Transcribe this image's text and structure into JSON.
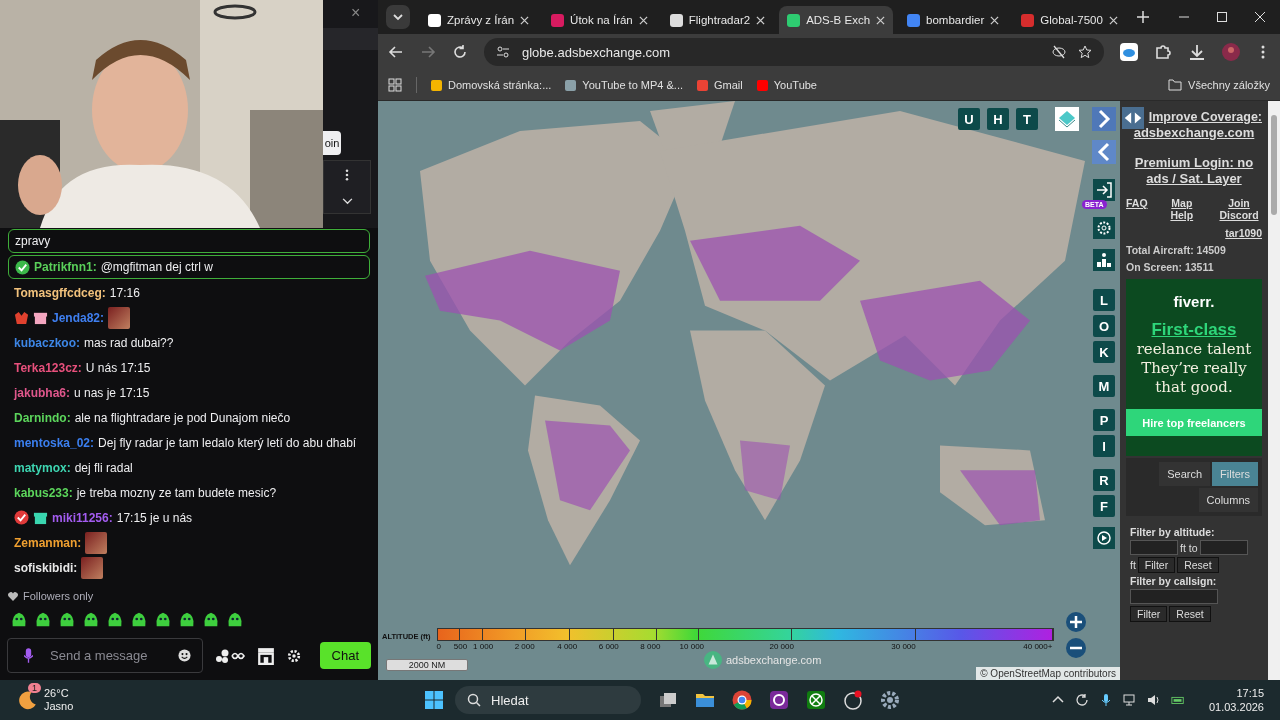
{
  "stream_panel": {
    "close": "×",
    "join_button": "oin"
  },
  "chat": {
    "messages": [
      {
        "text": "zpravy",
        "highlighted": true
      },
      {
        "user": "Patrikfnn1:",
        "color": "#5ad05a",
        "text": "@mgfitman dej ctrl w",
        "highlighted": true,
        "badges": [
          {
            "kind": "check",
            "color": "#3cb84a"
          }
        ]
      },
      {
        "user": "Tomasgffcdceg:",
        "color": "#f2c27c",
        "text": "17:16",
        "highlighted": false
      },
      {
        "user": "Jenda82:",
        "color": "#3f7ff0",
        "emote": true,
        "highlighted": false,
        "badges": [
          {
            "kind": "badge",
            "color": "#e0412e"
          },
          {
            "kind": "gift",
            "color": "#f4a6c0"
          }
        ]
      },
      {
        "user": "kubaczkoo:",
        "color": "#3d86e6",
        "text": "mas rad dubai??",
        "highlighted": false
      },
      {
        "user": "Terka123cz:",
        "color": "#e8507c",
        "text": "U nás 17:15",
        "highlighted": false
      },
      {
        "user": "jakubha6:",
        "color": "#e0578c",
        "text": "u nas je 17:15",
        "highlighted": false
      },
      {
        "user": "Darnindo:",
        "color": "#5cd65c",
        "text": "ale na flightradare je pod Dunajom niečo",
        "highlighted": false
      },
      {
        "user": "mentoska_02:",
        "color": "#3b7ff0",
        "text": "Dej fly radar je tam ledalo který letí do abu dhabí",
        "highlighted": false
      },
      {
        "user": "matymox:",
        "color": "#3ed6b2",
        "text": "dej fli radal",
        "highlighted": false
      },
      {
        "user": "kabus233:",
        "color": "#5cd65c",
        "text": "je treba mozny ze tam budete mesic?",
        "highlighted": false
      },
      {
        "user": "miki11256:",
        "color": "#a35cf0",
        "text": "17:15 je u nás",
        "highlighted": false,
        "badges": [
          {
            "kind": "check",
            "color": "#e03a3a"
          },
          {
            "kind": "gift",
            "color": "#3ad6b0"
          }
        ]
      },
      {
        "user": "Zemanman:",
        "color": "#f0a030",
        "emote": true,
        "highlighted": false
      },
      {
        "user": "sofiskibidi:",
        "color": "#e8e8e8",
        "emote": true,
        "highlighted": false
      }
    ],
    "followers_only": "Followers only",
    "input": {
      "placeholder": "Send a message"
    },
    "chat_button": "Chat"
  },
  "browser": {
    "tabs": [
      {
        "title": "Zprávy z Írán",
        "selected": false,
        "color": "#ffffff"
      },
      {
        "title": "Útok na Írán",
        "selected": false,
        "color": "#d81b60"
      },
      {
        "title": "Flightradar2",
        "selected": false,
        "color": "#dddddd"
      },
      {
        "title": "ADS-B Exch",
        "selected": true,
        "color": "#2ecc71"
      },
      {
        "title": "bombardier",
        "selected": false,
        "color": "#4285f4"
      },
      {
        "title": "Global-7500",
        "selected": false,
        "color": "#d62d2d"
      }
    ],
    "address": "globe.adsbexchange.com",
    "bookmarks": [
      {
        "label": "Domovská stránka:...",
        "color": "#f4b400"
      },
      {
        "label": "YouTube to MP4 &...",
        "color": "#8aa0a8"
      },
      {
        "label": "Gmail",
        "color": "#ea4335"
      },
      {
        "label": "YouTube",
        "color": "#ff0000"
      }
    ],
    "all_bookmarks": "Všechny záložky"
  },
  "map": {
    "top_buttons": [
      "U",
      "H",
      "T"
    ],
    "beta": "BETA",
    "side_buttons": [
      "L",
      "O",
      "K",
      "M",
      "P",
      "I",
      "R",
      "F"
    ],
    "legend": {
      "label": "ALTITUDE (ft)",
      "ticks": [
        "0",
        "500",
        "1 000",
        "2 000",
        "4 000",
        "6 000",
        "8 000",
        "10 000",
        "20 000",
        "30 000",
        "40 000+"
      ]
    },
    "scale": "2000 NM",
    "watermark": "adsbexchange.com",
    "attribution": "© OpenStreetMap contributors"
  },
  "sidebar": {
    "improve": "Improve Coverage:",
    "site_link": "adsbexchange.com",
    "premium": "Premium Login: no ads / Sat. Layer",
    "links": [
      "FAQ",
      "Map Help",
      "Join Discord"
    ],
    "version": "tar1090",
    "total": "Total Aircraft: 14509",
    "on_screen": "On Screen: 13511",
    "ad": {
      "logo": "fiverr.",
      "headline": "First-class",
      "line1": "reelance talent",
      "line2": "They’re really that good.",
      "button": "Hire top freelancers"
    },
    "tabs": [
      {
        "label": "Search",
        "selected": false
      },
      {
        "label": "Filters",
        "selected": true
      },
      {
        "label": "Columns",
        "selected": false
      }
    ],
    "altitude_label": "Filter by altitude:",
    "ft_to": "ft to",
    "ft": "ft",
    "altitude_filter": "Filter",
    "altitude_reset": "Reset",
    "callsign_label": "Filter by callsign:",
    "callsign_filter": "Filter",
    "callsign_reset": "Reset"
  },
  "taskbar": {
    "badge": "1",
    "temperature": "26°C",
    "condition": "Jasno",
    "search": "Hledat",
    "time": "17:15",
    "date": "01.03.2026"
  }
}
